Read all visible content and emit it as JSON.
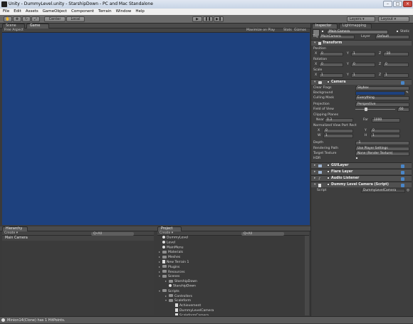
{
  "window": {
    "title": "Unity - DummyLevel.unity - StarshipDown - PC and Mac Standalone"
  },
  "menu": [
    "File",
    "Edit",
    "Assets",
    "GameObject",
    "Component",
    "Terrain",
    "Window",
    "Help"
  ],
  "toolbar": {
    "pivot": "Center",
    "space": "Local",
    "layers": "Layers",
    "layout": "Layout"
  },
  "scene": {
    "tabs": [
      "Scene",
      "Game"
    ],
    "aspect": "Free Aspect",
    "options": [
      "Maximize on Play",
      "Stats",
      "Gizmos"
    ]
  },
  "hierarchy": {
    "tab": "Hierarchy",
    "create": "Create",
    "search": "Q•All",
    "items": [
      "Main Camera"
    ]
  },
  "project": {
    "tab": "Project",
    "create": "Create",
    "search": "Q•All",
    "items": [
      {
        "label": "DummyLevel",
        "kind": "scene",
        "depth": 0
      },
      {
        "label": "Level",
        "kind": "scene",
        "depth": 0
      },
      {
        "label": "MainMenu",
        "kind": "scene",
        "depth": 0
      },
      {
        "label": "Materials",
        "kind": "folder",
        "depth": 0,
        "arrow": "▸"
      },
      {
        "label": "Meshes",
        "kind": "folder",
        "depth": 0,
        "arrow": "▸"
      },
      {
        "label": "New Terrain 1",
        "kind": "file",
        "depth": 0,
        "arrow": "▸"
      },
      {
        "label": "Plugins",
        "kind": "folder",
        "depth": 0,
        "arrow": "▸"
      },
      {
        "label": "Resources",
        "kind": "folder",
        "depth": 0,
        "arrow": "▸"
      },
      {
        "label": "Scenes",
        "kind": "folder",
        "depth": 0,
        "arrow": "▾"
      },
      {
        "label": "StarshipDown",
        "kind": "folder",
        "depth": 1,
        "arrow": "▸"
      },
      {
        "label": "StarshipDown",
        "kind": "scene",
        "depth": 1
      },
      {
        "label": "Scripts",
        "kind": "folder",
        "depth": 0,
        "arrow": "▾"
      },
      {
        "label": "Controllers",
        "kind": "folder",
        "depth": 1,
        "arrow": "▸"
      },
      {
        "label": "Scaleform",
        "kind": "folder",
        "depth": 1,
        "arrow": "▾"
      },
      {
        "label": "Achievement",
        "kind": "file",
        "depth": 2
      },
      {
        "label": "DummyLevelCamera",
        "kind": "file",
        "depth": 2
      },
      {
        "label": "ScaleformCamera",
        "kind": "file",
        "depth": 2
      }
    ]
  },
  "inspector": {
    "tabs": [
      "Inspector",
      "Lightmapping"
    ],
    "object_name": "Main Camera",
    "static_label": "Static",
    "tag_label": "Tag",
    "tag_value": "MainCamera",
    "layer_label": "Layer",
    "layer_value": "Default",
    "transform": {
      "title": "Transform",
      "position_label": "Position",
      "position": {
        "x": "0",
        "y": "1",
        "z": "-10"
      },
      "rotation_label": "Rotation",
      "rotation": {
        "x": "0",
        "y": "0",
        "z": "0"
      },
      "scale_label": "Scale",
      "scale": {
        "x": "1",
        "y": "1",
        "z": "1"
      }
    },
    "camera": {
      "title": "Camera",
      "clear_flags_label": "Clear Flags",
      "clear_flags": "Skybox",
      "background_label": "Background",
      "background_color": "#1e417e",
      "culling_mask_label": "Culling Mask",
      "culling_mask": "Everything",
      "projection_label": "Projection",
      "projection": "Perspective",
      "fov_label": "Field of View",
      "fov": "60",
      "clipping_label": "Clipping Planes",
      "near_label": "Near",
      "near": "0.3",
      "far_label": "Far",
      "far": "1000",
      "viewport_label": "Normalized View Port Rect",
      "vx_label": "X",
      "vx": "0",
      "vy_label": "Y",
      "vy": "0",
      "vw_label": "W",
      "vw": "1",
      "vh_label": "H",
      "vh": "1",
      "depth_label": "Depth",
      "depth": "-1",
      "rendering_path_label": "Rendering Path",
      "rendering_path": "Use Player Settings",
      "target_texture_label": "Target Texture",
      "target_texture": "None (Render Texture)",
      "hdr_label": "HDR"
    },
    "components": [
      "GUILayer",
      "Flare Layer",
      "Audio Listener",
      "Dummy Level Camera (Script)"
    ],
    "script_label": "Script",
    "script_value": "DummyLevelCamera"
  },
  "status": {
    "message": "Minion14(Clone) has 1 HitPoints."
  },
  "colors": {
    "scene_bg": "#1e417e",
    "panel": "#3a3a3a",
    "selected": "#4b4b4b"
  }
}
